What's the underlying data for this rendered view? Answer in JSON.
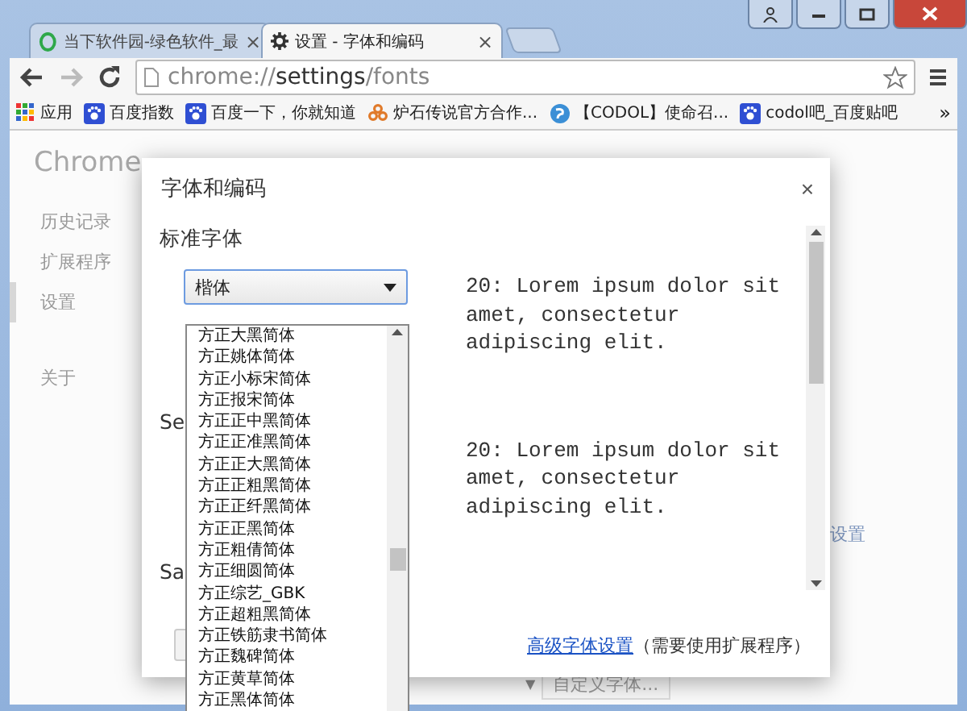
{
  "tabs": [
    {
      "title": "当下软件园-绿色软件_最",
      "close": "×",
      "selected": false,
      "kind": "site"
    },
    {
      "title": "设置 - 字体和编码",
      "close": "×",
      "selected": true,
      "kind": "settings"
    }
  ],
  "address": "chrome://**settings**/fonts",
  "bookmarks": [
    {
      "label": "应用",
      "kind": "apps"
    },
    {
      "label": "百度指数",
      "kind": "paw"
    },
    {
      "label": "百度一下，你就知道",
      "kind": "paw"
    },
    {
      "label": "炉石传说官方合作...",
      "kind": "flower"
    },
    {
      "label": "【CODOL】使命召...",
      "kind": "swirl"
    },
    {
      "label": "codol吧_百度贴吧",
      "kind": "paw"
    }
  ],
  "bookmarks_more": "»",
  "page": {
    "title": "Chrome",
    "nav": [
      {
        "label": "历史记录",
        "selected": false
      },
      {
        "label": "扩展程序",
        "selected": false
      },
      {
        "label": "设置",
        "selected": true
      },
      {
        "label": "关于",
        "selected": false
      }
    ],
    "side_link": "设置",
    "custom_font_button": "自定义字体..."
  },
  "dropdown_arrow": "▼",
  "dialog": {
    "title": "字体和编码",
    "close": "×",
    "standard_heading": "标准字体",
    "standard_value": "楷体",
    "standard_preview": "20: Lorem ipsum dolor sit amet, consectetur adipiscing elit.",
    "serif_heading": "Se",
    "serif_preview": "20: Lorem ipsum dolor sit amet, consectetur adipiscing elit.",
    "sans_heading": "Sa",
    "link": "高级字体设置",
    "link_note": "（需要使用扩展程序）"
  },
  "dropdown": {
    "options": [
      "方正大黑简体",
      "方正姚体简体",
      "方正小标宋简体",
      "方正报宋简体",
      "方正正中黑简体",
      "方正正准黑简体",
      "方正正大黑简体",
      "方正正粗黑简体",
      "方正正纤黑简体",
      "方正正黑简体",
      "方正粗倩简体",
      "方正细圆简体",
      "方正综艺_GBK",
      "方正超粗黑简体",
      "方正铁筋隶书简体",
      "方正魏碑简体",
      "方正黄草简体",
      "方正黑体简体"
    ]
  }
}
